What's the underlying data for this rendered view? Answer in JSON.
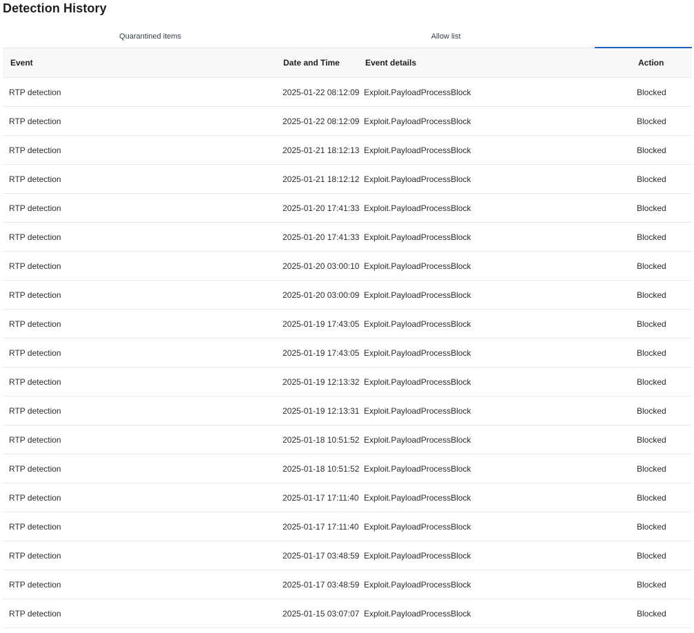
{
  "page": {
    "title": "Detection History"
  },
  "tabs": [
    {
      "label": "Quarantined items"
    },
    {
      "label": "Allow list"
    },
    {
      "label": ""
    }
  ],
  "table": {
    "columns": [
      "Event",
      "Date and Time",
      "Event details",
      "Action"
    ],
    "rows": [
      {
        "event": "RTP detection",
        "datetime": "2025-01-22 08:12:09",
        "details": "Exploit.PayloadProcessBlock",
        "action": "Blocked"
      },
      {
        "event": "RTP detection",
        "datetime": "2025-01-22 08:12:09",
        "details": "Exploit.PayloadProcessBlock",
        "action": "Blocked"
      },
      {
        "event": "RTP detection",
        "datetime": "2025-01-21 18:12:13",
        "details": "Exploit.PayloadProcessBlock",
        "action": "Blocked"
      },
      {
        "event": "RTP detection",
        "datetime": "2025-01-21 18:12:12",
        "details": "Exploit.PayloadProcessBlock",
        "action": "Blocked"
      },
      {
        "event": "RTP detection",
        "datetime": "2025-01-20 17:41:33",
        "details": "Exploit.PayloadProcessBlock",
        "action": "Blocked"
      },
      {
        "event": "RTP detection",
        "datetime": "2025-01-20 17:41:33",
        "details": "Exploit.PayloadProcessBlock",
        "action": "Blocked"
      },
      {
        "event": "RTP detection",
        "datetime": "2025-01-20 03:00:10",
        "details": "Exploit.PayloadProcessBlock",
        "action": "Blocked"
      },
      {
        "event": "RTP detection",
        "datetime": "2025-01-20 03:00:09",
        "details": "Exploit.PayloadProcessBlock",
        "action": "Blocked"
      },
      {
        "event": "RTP detection",
        "datetime": "2025-01-19 17:43:05",
        "details": "Exploit.PayloadProcessBlock",
        "action": "Blocked"
      },
      {
        "event": "RTP detection",
        "datetime": "2025-01-19 17:43:05",
        "details": "Exploit.PayloadProcessBlock",
        "action": "Blocked"
      },
      {
        "event": "RTP detection",
        "datetime": "2025-01-19 12:13:32",
        "details": "Exploit.PayloadProcessBlock",
        "action": "Blocked"
      },
      {
        "event": "RTP detection",
        "datetime": "2025-01-19 12:13:31",
        "details": "Exploit.PayloadProcessBlock",
        "action": "Blocked"
      },
      {
        "event": "RTP detection",
        "datetime": "2025-01-18 10:51:52",
        "details": "Exploit.PayloadProcessBlock",
        "action": "Blocked"
      },
      {
        "event": "RTP detection",
        "datetime": "2025-01-18 10:51:52",
        "details": "Exploit.PayloadProcessBlock",
        "action": "Blocked"
      },
      {
        "event": "RTP detection",
        "datetime": "2025-01-17 17:11:40",
        "details": "Exploit.PayloadProcessBlock",
        "action": "Blocked"
      },
      {
        "event": "RTP detection",
        "datetime": "2025-01-17 17:11:40",
        "details": "Exploit.PayloadProcessBlock",
        "action": "Blocked"
      },
      {
        "event": "RTP detection",
        "datetime": "2025-01-17 03:48:59",
        "details": "Exploit.PayloadProcessBlock",
        "action": "Blocked"
      },
      {
        "event": "RTP detection",
        "datetime": "2025-01-17 03:48:59",
        "details": "Exploit.PayloadProcessBlock",
        "action": "Blocked"
      },
      {
        "event": "RTP detection",
        "datetime": "2025-01-15 03:07:07",
        "details": "Exploit.PayloadProcessBlock",
        "action": "Blocked"
      }
    ]
  },
  "colors": {
    "active_tab_indicator": "#1f5fbf",
    "header_background": "#f6f7f8",
    "row_divider": "#e6e7ea"
  }
}
